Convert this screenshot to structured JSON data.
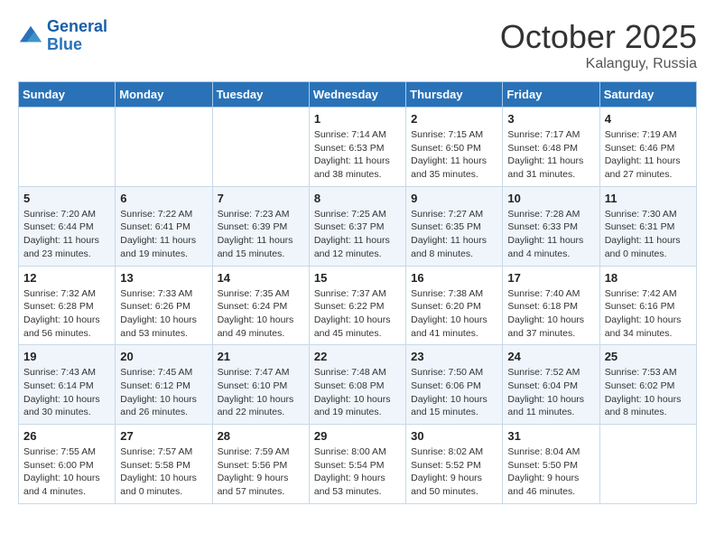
{
  "header": {
    "logo_line1": "General",
    "logo_line2": "Blue",
    "month": "October 2025",
    "location": "Kalanguy, Russia"
  },
  "days_of_week": [
    "Sunday",
    "Monday",
    "Tuesday",
    "Wednesday",
    "Thursday",
    "Friday",
    "Saturday"
  ],
  "weeks": [
    [
      {
        "num": "",
        "info": ""
      },
      {
        "num": "",
        "info": ""
      },
      {
        "num": "",
        "info": ""
      },
      {
        "num": "1",
        "info": "Sunrise: 7:14 AM\nSunset: 6:53 PM\nDaylight: 11 hours\nand 38 minutes."
      },
      {
        "num": "2",
        "info": "Sunrise: 7:15 AM\nSunset: 6:50 PM\nDaylight: 11 hours\nand 35 minutes."
      },
      {
        "num": "3",
        "info": "Sunrise: 7:17 AM\nSunset: 6:48 PM\nDaylight: 11 hours\nand 31 minutes."
      },
      {
        "num": "4",
        "info": "Sunrise: 7:19 AM\nSunset: 6:46 PM\nDaylight: 11 hours\nand 27 minutes."
      }
    ],
    [
      {
        "num": "5",
        "info": "Sunrise: 7:20 AM\nSunset: 6:44 PM\nDaylight: 11 hours\nand 23 minutes."
      },
      {
        "num": "6",
        "info": "Sunrise: 7:22 AM\nSunset: 6:41 PM\nDaylight: 11 hours\nand 19 minutes."
      },
      {
        "num": "7",
        "info": "Sunrise: 7:23 AM\nSunset: 6:39 PM\nDaylight: 11 hours\nand 15 minutes."
      },
      {
        "num": "8",
        "info": "Sunrise: 7:25 AM\nSunset: 6:37 PM\nDaylight: 11 hours\nand 12 minutes."
      },
      {
        "num": "9",
        "info": "Sunrise: 7:27 AM\nSunset: 6:35 PM\nDaylight: 11 hours\nand 8 minutes."
      },
      {
        "num": "10",
        "info": "Sunrise: 7:28 AM\nSunset: 6:33 PM\nDaylight: 11 hours\nand 4 minutes."
      },
      {
        "num": "11",
        "info": "Sunrise: 7:30 AM\nSunset: 6:31 PM\nDaylight: 11 hours\nand 0 minutes."
      }
    ],
    [
      {
        "num": "12",
        "info": "Sunrise: 7:32 AM\nSunset: 6:28 PM\nDaylight: 10 hours\nand 56 minutes."
      },
      {
        "num": "13",
        "info": "Sunrise: 7:33 AM\nSunset: 6:26 PM\nDaylight: 10 hours\nand 53 minutes."
      },
      {
        "num": "14",
        "info": "Sunrise: 7:35 AM\nSunset: 6:24 PM\nDaylight: 10 hours\nand 49 minutes."
      },
      {
        "num": "15",
        "info": "Sunrise: 7:37 AM\nSunset: 6:22 PM\nDaylight: 10 hours\nand 45 minutes."
      },
      {
        "num": "16",
        "info": "Sunrise: 7:38 AM\nSunset: 6:20 PM\nDaylight: 10 hours\nand 41 minutes."
      },
      {
        "num": "17",
        "info": "Sunrise: 7:40 AM\nSunset: 6:18 PM\nDaylight: 10 hours\nand 37 minutes."
      },
      {
        "num": "18",
        "info": "Sunrise: 7:42 AM\nSunset: 6:16 PM\nDaylight: 10 hours\nand 34 minutes."
      }
    ],
    [
      {
        "num": "19",
        "info": "Sunrise: 7:43 AM\nSunset: 6:14 PM\nDaylight: 10 hours\nand 30 minutes."
      },
      {
        "num": "20",
        "info": "Sunrise: 7:45 AM\nSunset: 6:12 PM\nDaylight: 10 hours\nand 26 minutes."
      },
      {
        "num": "21",
        "info": "Sunrise: 7:47 AM\nSunset: 6:10 PM\nDaylight: 10 hours\nand 22 minutes."
      },
      {
        "num": "22",
        "info": "Sunrise: 7:48 AM\nSunset: 6:08 PM\nDaylight: 10 hours\nand 19 minutes."
      },
      {
        "num": "23",
        "info": "Sunrise: 7:50 AM\nSunset: 6:06 PM\nDaylight: 10 hours\nand 15 minutes."
      },
      {
        "num": "24",
        "info": "Sunrise: 7:52 AM\nSunset: 6:04 PM\nDaylight: 10 hours\nand 11 minutes."
      },
      {
        "num": "25",
        "info": "Sunrise: 7:53 AM\nSunset: 6:02 PM\nDaylight: 10 hours\nand 8 minutes."
      }
    ],
    [
      {
        "num": "26",
        "info": "Sunrise: 7:55 AM\nSunset: 6:00 PM\nDaylight: 10 hours\nand 4 minutes."
      },
      {
        "num": "27",
        "info": "Sunrise: 7:57 AM\nSunset: 5:58 PM\nDaylight: 10 hours\nand 0 minutes."
      },
      {
        "num": "28",
        "info": "Sunrise: 7:59 AM\nSunset: 5:56 PM\nDaylight: 9 hours\nand 57 minutes."
      },
      {
        "num": "29",
        "info": "Sunrise: 8:00 AM\nSunset: 5:54 PM\nDaylight: 9 hours\nand 53 minutes."
      },
      {
        "num": "30",
        "info": "Sunrise: 8:02 AM\nSunset: 5:52 PM\nDaylight: 9 hours\nand 50 minutes."
      },
      {
        "num": "31",
        "info": "Sunrise: 8:04 AM\nSunset: 5:50 PM\nDaylight: 9 hours\nand 46 minutes."
      },
      {
        "num": "",
        "info": ""
      }
    ]
  ]
}
